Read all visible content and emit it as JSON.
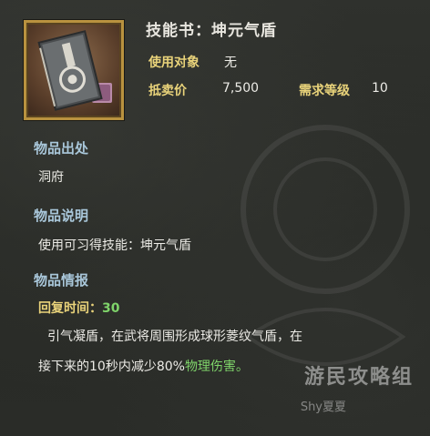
{
  "item": {
    "title": "技能书：坤元气盾",
    "target_label": "使用对象",
    "target_value": "无",
    "price_label": "抵卖价",
    "price_value": "7,500",
    "level_label": "需求等级",
    "level_value": "10"
  },
  "sections": {
    "origin_title": "物品出处",
    "origin_text": "洞府",
    "desc_title": "物品说明",
    "desc_text": "使用可习得技能：坤元气盾",
    "info_title": "物品情报",
    "cooldown_label": "回复时间：",
    "cooldown_value": "30",
    "info_line1": "引气凝盾，在武将周围形成球形菱纹气盾，在",
    "info_line2_prefix": "接下来的10秒内减少80%",
    "info_line2_green": "物理伤害。"
  },
  "watermark": {
    "text": "游民攻略组",
    "sub": "Shy夏夏"
  },
  "colors": {
    "title": "#e8e6df",
    "label_gold": "#e9d37a",
    "section_blue": "#a9c7da",
    "highlight_green": "#7fd46a",
    "frame_gold": "#b9923f"
  },
  "icons": {
    "item": "skill-book-icon"
  }
}
